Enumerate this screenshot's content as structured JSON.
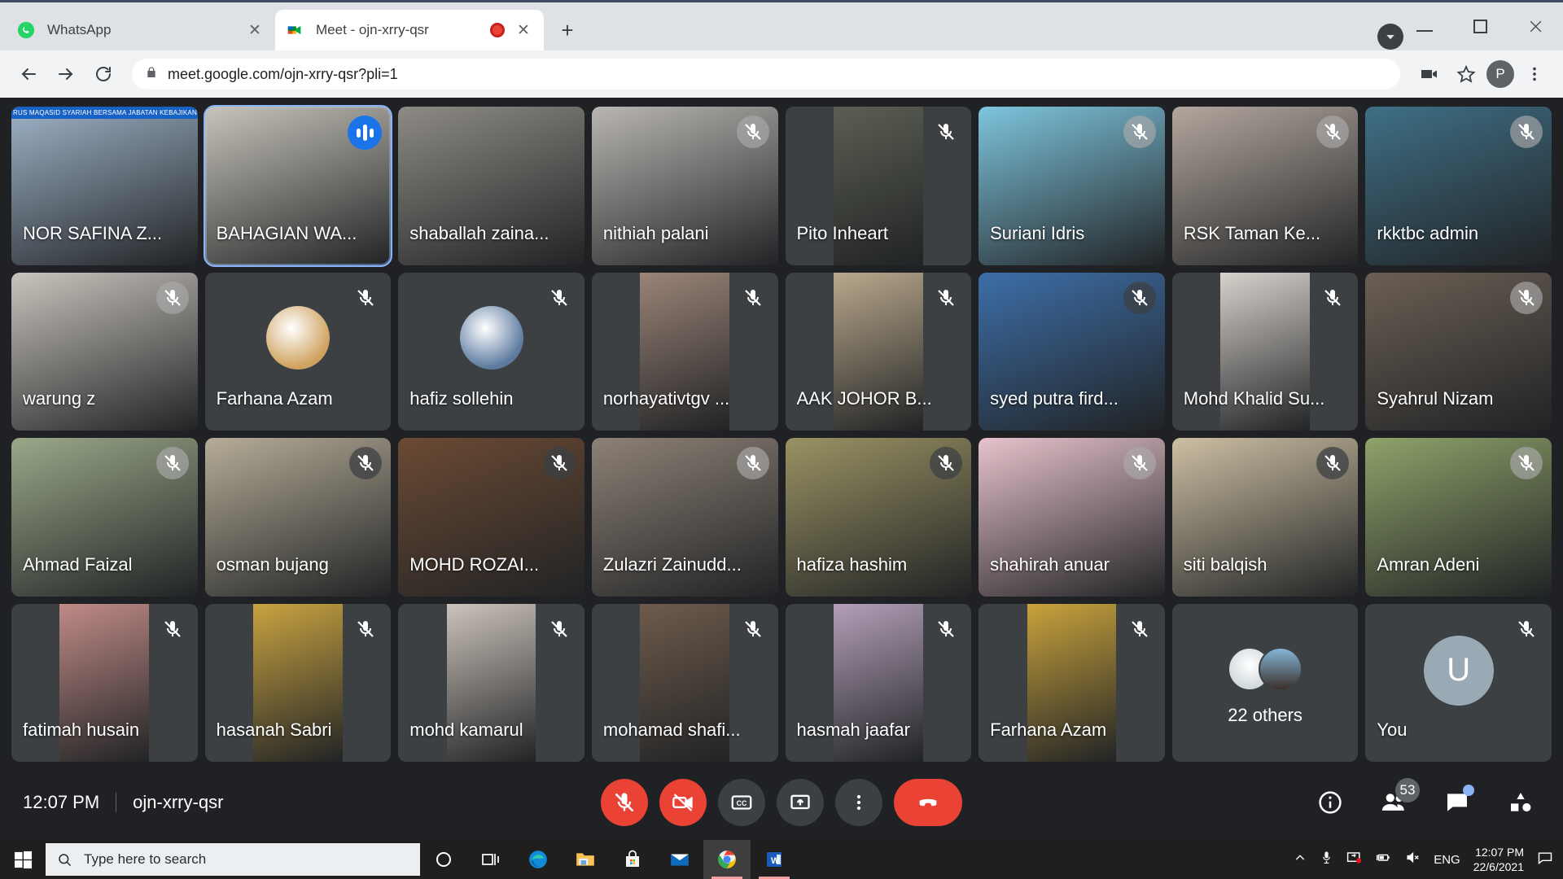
{
  "browser": {
    "tabs": [
      {
        "title": "WhatsApp",
        "favicon": "whatsapp-icon",
        "active": false,
        "recording": false
      },
      {
        "title": "Meet - ojn-xrry-qsr",
        "favicon": "google-meet-icon",
        "active": true,
        "recording": true
      }
    ],
    "new_tab_label": "+",
    "close_label": "✕",
    "url": "meet.google.com/ojn-xrry-qsr?pli=1",
    "profile_initial": "P"
  },
  "meet": {
    "time": "12:07 PM",
    "meeting_code": "ojn-xrry-qsr",
    "participants": [
      {
        "name": "NOR SAFINA Z...",
        "type": "video",
        "muted": false,
        "speaking": false,
        "banner": "RUS MAQASID SYARIAH BERSAMA JABATAN KEBAJIKAN MASYA",
        "bg": "#9fb3c8",
        "narrow": false
      },
      {
        "name": "BAHAGIAN WA...",
        "type": "video",
        "muted": false,
        "speaking": true,
        "bg": "#c8c4bb",
        "narrow": false
      },
      {
        "name": "shaballah zaina...",
        "type": "video",
        "muted": false,
        "speaking": false,
        "bg": "#8e8b85",
        "narrow": false
      },
      {
        "name": "nithiah palani",
        "type": "video",
        "muted": true,
        "speaking": false,
        "bg": "#b9b6b2",
        "narrow": false,
        "light_badge": true
      },
      {
        "name": "Pito Inheart",
        "type": "video",
        "muted": true,
        "speaking": false,
        "bg": "#5b5f52",
        "narrow": true
      },
      {
        "name": "Suriani Idris",
        "type": "video",
        "muted": true,
        "speaking": false,
        "bg": "#7ec5dd",
        "narrow": false,
        "light_badge": true
      },
      {
        "name": "RSK Taman Ke...",
        "type": "video",
        "muted": true,
        "speaking": false,
        "bg": "#b3a79e",
        "narrow": false,
        "light_badge": true
      },
      {
        "name": "rkktbc admin",
        "type": "video",
        "muted": true,
        "speaking": false,
        "bg": "#3f6f86",
        "narrow": false,
        "light_badge": true
      },
      {
        "name": "warung z",
        "type": "video",
        "muted": true,
        "speaking": false,
        "bg": "#c9c4bd",
        "narrow": false,
        "light_badge": true
      },
      {
        "name": "Farhana Azam",
        "type": "avatar",
        "muted": true,
        "speaking": false,
        "avatar_bg": "#cfa25f"
      },
      {
        "name": "hafiz sollehin",
        "type": "avatar",
        "muted": true,
        "speaking": false,
        "avatar_bg": "#5d7ba0"
      },
      {
        "name": "norhayativtgv ...",
        "type": "video",
        "muted": true,
        "speaking": false,
        "bg": "#9b8478",
        "narrow": true
      },
      {
        "name": "AAK JOHOR B...",
        "type": "video",
        "muted": true,
        "speaking": false,
        "bg": "#b9a88c",
        "narrow": true
      },
      {
        "name": "syed putra fird...",
        "type": "video",
        "muted": true,
        "speaking": false,
        "bg": "#3d6ea8",
        "narrow": false
      },
      {
        "name": "Mohd Khalid Su...",
        "type": "video",
        "muted": true,
        "speaking": false,
        "bg": "#d8d2cc",
        "narrow": true
      },
      {
        "name": "Syahrul Nizam",
        "type": "video",
        "muted": true,
        "speaking": false,
        "bg": "#6b5f54",
        "narrow": false,
        "light_badge": true
      },
      {
        "name": "Ahmad Faizal",
        "type": "video",
        "muted": true,
        "speaking": false,
        "bg": "#9aa889",
        "narrow": false,
        "light_badge": true
      },
      {
        "name": "osman bujang",
        "type": "video",
        "muted": true,
        "speaking": false,
        "bg": "#b6ac98",
        "narrow": false
      },
      {
        "name": "MOHD ROZAI...",
        "type": "video",
        "muted": true,
        "speaking": false,
        "bg": "#6b4a33",
        "narrow": false
      },
      {
        "name": "Zulazri Zainudd...",
        "type": "video",
        "muted": true,
        "speaking": false,
        "bg": "#8d8176",
        "narrow": false,
        "light_badge": true
      },
      {
        "name": "hafiza hashim",
        "type": "video",
        "muted": true,
        "speaking": false,
        "bg": "#9a9263",
        "narrow": false
      },
      {
        "name": "shahirah anuar",
        "type": "video",
        "muted": true,
        "speaking": false,
        "bg": "#e8c3cc",
        "narrow": false,
        "light_badge": true
      },
      {
        "name": "siti balqish",
        "type": "video",
        "muted": true,
        "speaking": false,
        "bg": "#cdbfa3",
        "narrow": false
      },
      {
        "name": "Amran Adeni",
        "type": "video",
        "muted": true,
        "speaking": false,
        "bg": "#8fa36a",
        "narrow": false,
        "light_badge": true
      },
      {
        "name": "fatimah husain",
        "type": "video",
        "muted": true,
        "speaking": false,
        "bg": "#c08b87",
        "narrow": true
      },
      {
        "name": "hasanah Sabri",
        "type": "video",
        "muted": true,
        "speaking": false,
        "bg": "#c9a341",
        "narrow": true
      },
      {
        "name": "mohd kamarul",
        "type": "video",
        "muted": true,
        "speaking": false,
        "bg": "#ccc3bb",
        "narrow": true
      },
      {
        "name": "mohamad shafi...",
        "type": "video",
        "muted": true,
        "speaking": false,
        "bg": "#6e5b4c",
        "narrow": true
      },
      {
        "name": "hasmah jaafar",
        "type": "video",
        "muted": true,
        "speaking": false,
        "bg": "#b39fb8",
        "narrow": true
      },
      {
        "name": "Farhana Azam",
        "type": "video",
        "muted": true,
        "speaking": false,
        "bg": "#c8a23c",
        "narrow": true
      },
      {
        "name": "22 others",
        "type": "others",
        "muted": false,
        "speaking": false
      },
      {
        "name": "You",
        "type": "you",
        "muted": true,
        "speaking": false,
        "initial": "U"
      }
    ],
    "controls": [
      {
        "name": "microphone-off-button",
        "icon": "mic-off-icon",
        "style": "danger"
      },
      {
        "name": "camera-off-button",
        "icon": "video-off-icon",
        "style": "danger"
      },
      {
        "name": "captions-button",
        "icon": "cc-icon",
        "style": "normal"
      },
      {
        "name": "present-button",
        "icon": "present-icon",
        "style": "normal"
      },
      {
        "name": "more-options-button",
        "icon": "more-vertical-icon",
        "style": "normal"
      },
      {
        "name": "hangup-button",
        "icon": "call-end-icon",
        "style": "hangup"
      }
    ],
    "right_controls": {
      "info_label": "Meeting details",
      "people_count": "53",
      "chat_has_unread": true,
      "activities_label": "Activities"
    }
  },
  "taskbar": {
    "search_placeholder": "Type here to search",
    "apps": [
      "cortana-icon",
      "task-view-icon",
      "edge-icon",
      "file-explorer-icon",
      "microsoft-store-icon",
      "mail-icon",
      "chrome-icon",
      "word-icon"
    ],
    "tray": {
      "language": "ENG",
      "time": "12:07 PM",
      "date": "22/6/2021"
    }
  }
}
